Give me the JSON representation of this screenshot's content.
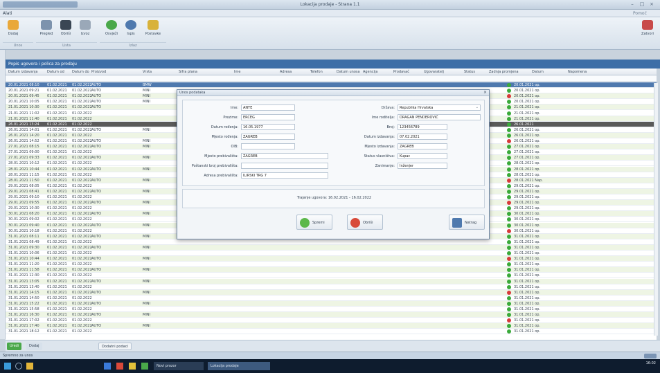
{
  "window": {
    "title": "Lokacija prodaje - Strana 1.1"
  },
  "menu": {
    "file": "Alati",
    "help": "Pomoć"
  },
  "ribbon": {
    "buttons": [
      "Dodaj",
      "Pregled",
      "Obriši",
      "Izvoz",
      "Osvježi",
      "Ispis",
      "Postavke",
      "Zatvori"
    ],
    "groups": [
      "Unos",
      "Lista",
      "Izlaz"
    ]
  },
  "panel": {
    "title": "Popis ugovora i polica za prodaju"
  },
  "grid": {
    "columns": [
      "Datum izdavanja",
      "Datum od",
      "Datum do",
      "Proizvod",
      "Vrsta",
      "Sifra plana",
      "Ime",
      "Adresa",
      "Telefon",
      "Datum unosa",
      "Agencija",
      "Prodavač",
      "Ugovaratelj",
      "Status",
      "Zadnja promjena",
      "Datum",
      "Napomena"
    ],
    "rows": [
      {
        "a": "20.01.2021 08:10",
        "b": "01.02.2021",
        "c": "01.02.2022",
        "d": "AUTO",
        "e": "BMW",
        "s": "green",
        "dt": "20.01.2021 op.",
        "cls": "sel"
      },
      {
        "a": "20.01.2021 09:21",
        "b": "01.02.2021",
        "c": "01.02.2022",
        "d": "AUTO",
        "e": "MINI",
        "s": "green",
        "dt": "20.01.2021 op.",
        "cls": ""
      },
      {
        "a": "20.01.2021 09:45",
        "b": "01.02.2021",
        "c": "01.02.2022",
        "d": "AUTO",
        "e": "MINI",
        "s": "red",
        "dt": "20.01.2021 op.",
        "cls": "alt"
      },
      {
        "a": "20.01.2021 10:05",
        "b": "01.02.2021",
        "c": "01.02.2022",
        "d": "AUTO",
        "e": "MINI",
        "s": "green",
        "dt": "20.01.2021 op.",
        "cls": ""
      },
      {
        "a": "21.01.2021 10:30",
        "b": "01.02.2021",
        "c": "01.02.2022",
        "d": "AUTO",
        "e": "",
        "s": "green",
        "dt": "21.01.2021 op.",
        "cls": "alt"
      },
      {
        "a": "21.01.2021 11:02",
        "b": "01.02.2021",
        "c": "01.02.2022",
        "d": "",
        "e": "",
        "s": "green",
        "dt": "21.01.2021 op.",
        "cls": ""
      },
      {
        "a": "21.01.2021 11:40",
        "b": "01.02.2021",
        "c": "01.02.2022",
        "d": "",
        "e": "",
        "s": "green",
        "dt": "21.01.2021 op.",
        "cls": "alt"
      },
      {
        "a": "26.01.2021 13:24",
        "b": "01.02.2021",
        "c": "01.02.2022",
        "d": "",
        "e": "",
        "s": "green",
        "dt": "26.01.2021",
        "cls": "cur"
      },
      {
        "a": "26.01.2021 14:01",
        "b": "01.02.2021",
        "c": "01.02.2022",
        "d": "AUTO",
        "e": "MINI",
        "s": "green",
        "dt": "26.01.2021 op.",
        "cls": ""
      },
      {
        "a": "26.01.2021 14:20",
        "b": "01.02.2021",
        "c": "01.02.2022",
        "d": "",
        "e": "",
        "s": "green",
        "dt": "26.01.2021 op.",
        "cls": "alt"
      },
      {
        "a": "26.01.2021 14:52",
        "b": "01.02.2021",
        "c": "01.02.2022",
        "d": "AUTO",
        "e": "MINI",
        "s": "red",
        "dt": "26.01.2021 op.",
        "cls": ""
      },
      {
        "a": "27.01.2021 08:15",
        "b": "01.02.2021",
        "c": "01.02.2022",
        "d": "AUTO",
        "e": "MINI",
        "s": "green",
        "dt": "27.01.2021 op.",
        "cls": "alt"
      },
      {
        "a": "27.01.2021 09:00",
        "b": "01.02.2021",
        "c": "01.02.2022",
        "d": "",
        "e": "",
        "s": "green",
        "dt": "27.01.2021 op.",
        "cls": ""
      },
      {
        "a": "27.01.2021 09:33",
        "b": "01.02.2021",
        "c": "01.02.2022",
        "d": "AUTO",
        "e": "MINI",
        "s": "green",
        "dt": "27.01.2021 op.",
        "cls": "alt"
      },
      {
        "a": "28.01.2021 10:12",
        "b": "01.02.2021",
        "c": "01.02.2022",
        "d": "",
        "e": "",
        "s": "green",
        "dt": "28.01.2021 op.",
        "cls": ""
      },
      {
        "a": "28.01.2021 10:44",
        "b": "01.02.2021",
        "c": "01.02.2022",
        "d": "AUTO",
        "e": "MINI",
        "s": "green",
        "dt": "28.01.2021 op.",
        "cls": "alt"
      },
      {
        "a": "28.01.2021 11:15",
        "b": "01.02.2021",
        "c": "01.02.2022",
        "d": "",
        "e": "",
        "s": "green",
        "dt": "28.01.2021 op.",
        "cls": ""
      },
      {
        "a": "28.01.2021 11:50",
        "b": "01.02.2021",
        "c": "01.02.2022",
        "d": "AUTO",
        "e": "MINI",
        "s": "red",
        "dt": "28.01.2021 Nap.",
        "cls": "alt"
      },
      {
        "a": "29.01.2021 08:05",
        "b": "01.02.2021",
        "c": "01.02.2022",
        "d": "",
        "e": "",
        "s": "green",
        "dt": "29.01.2021 op.",
        "cls": ""
      },
      {
        "a": "29.01.2021 08:41",
        "b": "01.02.2021",
        "c": "01.02.2022",
        "d": "AUTO",
        "e": "MINI",
        "s": "green",
        "dt": "29.01.2021 op.",
        "cls": "alt"
      },
      {
        "a": "29.01.2021 09:10",
        "b": "01.02.2021",
        "c": "01.02.2022",
        "d": "",
        "e": "",
        "s": "green",
        "dt": "29.01.2021 op.",
        "cls": ""
      },
      {
        "a": "29.01.2021 09:55",
        "b": "01.02.2021",
        "c": "01.02.2022",
        "d": "AUTO",
        "e": "MINI",
        "s": "red",
        "dt": "29.01.2021 op.",
        "cls": "alt"
      },
      {
        "a": "29.01.2021 10:30",
        "b": "01.02.2021",
        "c": "01.02.2022",
        "d": "",
        "e": "",
        "s": "green",
        "dt": "29.01.2021 op.",
        "cls": ""
      },
      {
        "a": "30.01.2021 08:20",
        "b": "01.02.2021",
        "c": "01.02.2022",
        "d": "AUTO",
        "e": "MINI",
        "s": "green",
        "dt": "30.01.2021 op.",
        "cls": "alt"
      },
      {
        "a": "30.01.2021 09:02",
        "b": "01.02.2021",
        "c": "01.02.2022",
        "d": "",
        "e": "",
        "s": "green",
        "dt": "30.01.2021 op.",
        "cls": ""
      },
      {
        "a": "30.01.2021 09:40",
        "b": "01.02.2021",
        "c": "01.02.2022",
        "d": "AUTO",
        "e": "MINI",
        "s": "green",
        "dt": "30.01.2021 op.",
        "cls": "alt"
      },
      {
        "a": "30.01.2021 10:18",
        "b": "01.02.2021",
        "c": "01.02.2022",
        "d": "",
        "e": "",
        "s": "red",
        "dt": "30.01.2021 op.",
        "cls": ""
      },
      {
        "a": "31.01.2021 08:11",
        "b": "01.02.2021",
        "c": "01.02.2022",
        "d": "AUTO",
        "e": "MINI",
        "s": "green",
        "dt": "31.01.2021 op.",
        "cls": "alt"
      },
      {
        "a": "31.01.2021 08:49",
        "b": "01.02.2021",
        "c": "01.02.2022",
        "d": "",
        "e": "",
        "s": "green",
        "dt": "31.01.2021 op.",
        "cls": ""
      },
      {
        "a": "31.01.2021 09:30",
        "b": "01.02.2021",
        "c": "01.02.2022",
        "d": "AUTO",
        "e": "MINI",
        "s": "green",
        "dt": "31.01.2021 op.",
        "cls": "alt"
      },
      {
        "a": "31.01.2021 10:06",
        "b": "01.02.2021",
        "c": "01.02.2022",
        "d": "",
        "e": "",
        "s": "green",
        "dt": "31.01.2021 op.",
        "cls": ""
      },
      {
        "a": "31.01.2021 10:44",
        "b": "01.02.2021",
        "c": "01.02.2022",
        "d": "AUTO",
        "e": "MINI",
        "s": "red",
        "dt": "31.01.2021 op.",
        "cls": "alt"
      },
      {
        "a": "31.01.2021 11:20",
        "b": "01.02.2021",
        "c": "01.02.2022",
        "d": "",
        "e": "",
        "s": "green",
        "dt": "31.01.2021 op.",
        "cls": ""
      },
      {
        "a": "31.01.2021 11:58",
        "b": "01.02.2021",
        "c": "01.02.2022",
        "d": "AUTO",
        "e": "MINI",
        "s": "green",
        "dt": "31.01.2021 op.",
        "cls": "alt"
      },
      {
        "a": "31.01.2021 12:30",
        "b": "01.02.2021",
        "c": "01.02.2022",
        "d": "",
        "e": "",
        "s": "green",
        "dt": "31.01.2021 op.",
        "cls": ""
      },
      {
        "a": "31.01.2021 13:05",
        "b": "01.02.2021",
        "c": "01.02.2022",
        "d": "AUTO",
        "e": "MINI",
        "s": "green",
        "dt": "31.01.2021 op.",
        "cls": "alt"
      },
      {
        "a": "31.01.2021 13:40",
        "b": "01.02.2021",
        "c": "01.02.2022",
        "d": "",
        "e": "",
        "s": "green",
        "dt": "31.01.2021 op.",
        "cls": ""
      },
      {
        "a": "31.01.2021 14:15",
        "b": "01.02.2021",
        "c": "01.02.2022",
        "d": "AUTO",
        "e": "MINI",
        "s": "red",
        "dt": "31.01.2021 op.",
        "cls": "alt"
      },
      {
        "a": "31.01.2021 14:50",
        "b": "01.02.2021",
        "c": "01.02.2022",
        "d": "",
        "e": "",
        "s": "green",
        "dt": "31.01.2021 op.",
        "cls": ""
      },
      {
        "a": "31.01.2021 15:22",
        "b": "01.02.2021",
        "c": "01.02.2022",
        "d": "AUTO",
        "e": "MINI",
        "s": "green",
        "dt": "31.01.2021 op.",
        "cls": "alt"
      },
      {
        "a": "31.01.2021 15:58",
        "b": "01.02.2021",
        "c": "01.02.2022",
        "d": "",
        "e": "",
        "s": "green",
        "dt": "31.01.2021 op.",
        "cls": ""
      },
      {
        "a": "31.01.2021 16:30",
        "b": "01.02.2021",
        "c": "01.02.2022",
        "d": "AUTO",
        "e": "MINI",
        "s": "green",
        "dt": "31.01.2021 op.",
        "cls": "alt"
      },
      {
        "a": "31.01.2021 17:02",
        "b": "01.02.2021",
        "c": "01.02.2022",
        "d": "",
        "e": "",
        "s": "red",
        "dt": "31.01.2021 op.",
        "cls": ""
      },
      {
        "a": "31.01.2021 17:40",
        "b": "01.02.2021",
        "c": "01.02.2022",
        "d": "AUTO",
        "e": "MINI",
        "s": "green",
        "dt": "31.01.2021 op.",
        "cls": "alt"
      },
      {
        "a": "31.01.2021 18:12",
        "b": "01.02.2021",
        "c": "01.02.2022",
        "d": "",
        "e": "",
        "s": "green",
        "dt": "31.01.2021 op.",
        "cls": ""
      }
    ]
  },
  "dialog": {
    "title": "Unos podataka",
    "close": "×",
    "fields_left": [
      {
        "label": "Ime:",
        "value": "ANTE"
      },
      {
        "label": "Prezime:",
        "value": "ERCEG"
      },
      {
        "label": "Datum rođenja:",
        "value": "16.05.1977"
      },
      {
        "label": "Mjesto rođenja:",
        "value": "ZAGREB"
      },
      {
        "label": "OIB:",
        "value": ""
      },
      {
        "label": "Mjesto prebivališta:",
        "value": "ZAGREB"
      },
      {
        "label": "Poštanski broj prebivališta:",
        "value": ""
      },
      {
        "label": "Adresa prebivališta:",
        "value": "ILIRSKI TRG 7"
      }
    ],
    "fields_right": [
      {
        "label": "Država:",
        "value": "Republika Hrvatska"
      },
      {
        "label": "Ime roditelja:",
        "value": "DRAGAN PENDEROVIĆ"
      },
      {
        "label": "Broj:",
        "value": "123456789"
      },
      {
        "label": "Datum izdavanja:",
        "value": "07.02.2021"
      },
      {
        "label": "Mjesto izdavanja:",
        "value": "ZAGREB"
      },
      {
        "label": "Status vlasništva:",
        "value": "Kupac"
      },
      {
        "label": "Zanimanje:",
        "value": "Inženjer"
      }
    ],
    "period_text": "Trajanje ugovora: 16.02.2021 - 16.02.2022",
    "buttons": {
      "save": "Spremi",
      "delete": "Obriši",
      "back": "Natrag"
    }
  },
  "footer": {
    "buttons": [
      "Uredi",
      "Dodaj",
      "Dodatni podaci"
    ]
  },
  "status": {
    "text": "Spremno za unos"
  },
  "taskbar": {
    "apps": [
      "Novi prozor",
      "Lokacija prodaje"
    ],
    "clock": "16:02"
  },
  "colors": {
    "accent": "#3d6ea7",
    "selected": "#4f79ae",
    "ok": "#3aaa3a",
    "error": "#d83a3a"
  }
}
